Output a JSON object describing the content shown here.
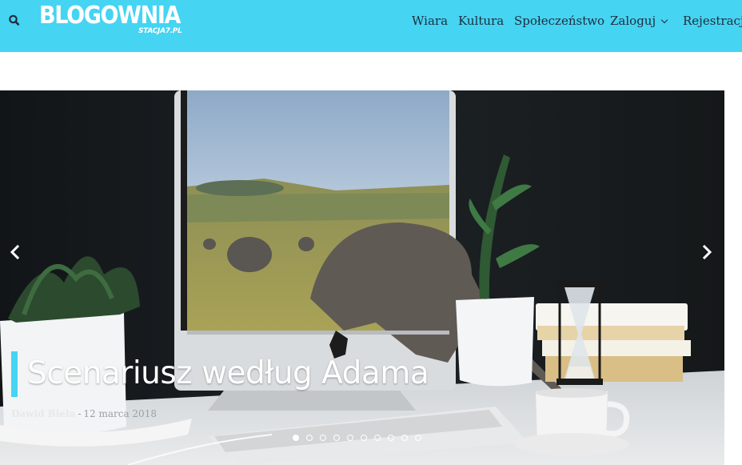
{
  "header": {
    "logo_main": "BLOGOWNIA",
    "logo_sub": "STACJA7.PL",
    "nav": [
      {
        "label": "Wiara"
      },
      {
        "label": "Kultura"
      },
      {
        "label": "Społeczeństwo"
      },
      {
        "label": "Zaloguj"
      },
      {
        "label": "Rejestracja"
      }
    ],
    "search_icon": "search-icon",
    "dropdown_icon": "chevron-down-icon"
  },
  "slider": {
    "title": "Scenariusz według Adama",
    "author": "Dawid Biela",
    "separator": "-",
    "date": "12 marca 2018",
    "slide_count": 10,
    "active_slide": 1,
    "prev_icon": "chevron-left-icon",
    "next_icon": "chevron-right-icon"
  },
  "colors": {
    "accent": "#45d4f2",
    "nav_text": "#1f2d3d"
  }
}
